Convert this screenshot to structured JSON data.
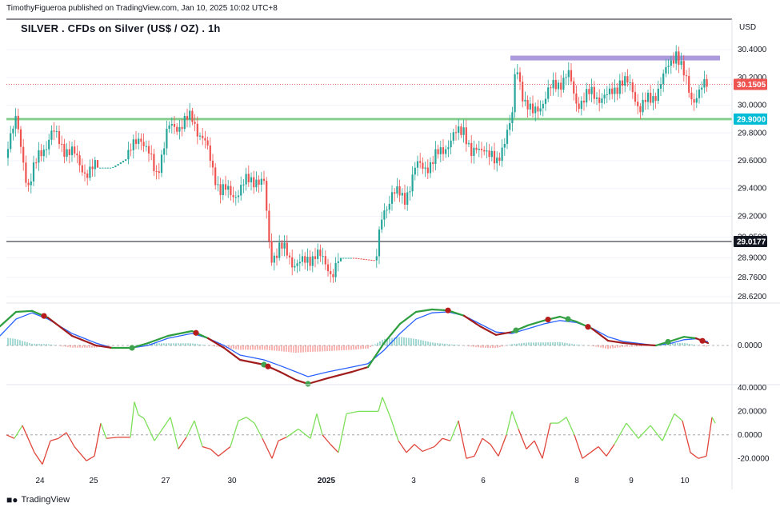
{
  "header": {
    "credit": "TimothyFigueroa published on TradingView.com, Jan 10, 2025 10:02 UTC+8",
    "title": "SILVER . CFDs on Silver (US$ / OZ) . 1h",
    "currency": "USD"
  },
  "footer": {
    "brand": "TradingView",
    "logo_icon": "tradingview-logo-icon"
  },
  "colors": {
    "up": "#26a69a",
    "down": "#ef5350",
    "grid": "#f0f3fa",
    "support_line": "#4caf50",
    "resistance_zone": "#9c88d6",
    "black_line": "#131722",
    "macd_fast": "#2e9e3f",
    "macd_slow": "#2962ff",
    "macd_down": "#a11d1d",
    "osc_up": "#7ee05a",
    "osc_down": "#e0463c"
  },
  "chart_data": [
    {
      "type": "candlestick",
      "title": "SILVER . CFDs on Silver (US$ / OZ) . 1h",
      "y_ticks": [
        28.62,
        28.76,
        28.9,
        29.05,
        29.2,
        29.4,
        29.6,
        29.8,
        30.0,
        30.2,
        30.4
      ],
      "y_tick_labels": [
        "28.6200",
        "28.7600",
        "28.9000",
        "29.0500",
        "29.2000",
        "29.4000",
        "29.6000",
        "29.8000",
        "30.0000",
        "30.2000",
        "30.4000"
      ],
      "ylim": [
        28.58,
        30.47
      ],
      "x_ticks": [
        "24",
        "25",
        "27",
        "30",
        "2025",
        "3",
        "6",
        "8",
        "9",
        "10"
      ],
      "price_markers": [
        {
          "label": "30.1505",
          "value": 30.1505,
          "style": "last-price"
        },
        {
          "label": "29.9000",
          "value": 29.9,
          "style": "support"
        },
        {
          "label": "29.0177",
          "value": 29.0177,
          "style": "level"
        }
      ],
      "horizontal_levels": [
        {
          "value": 29.9,
          "kind": "support"
        },
        {
          "value": 29.0177,
          "kind": "level"
        },
        {
          "value": 30.34,
          "kind": "resistance-zone"
        }
      ],
      "path_points": [
        [
          0,
          29.62
        ],
        [
          20,
          29.88
        ],
        [
          35,
          29.42
        ],
        [
          50,
          29.65
        ],
        [
          65,
          29.8
        ],
        [
          80,
          29.7
        ],
        [
          95,
          29.62
        ],
        [
          110,
          29.5
        ],
        [
          120,
          29.55
        ],
        [
          140,
          29.55
        ],
        [
          160,
          29.62
        ],
        [
          175,
          29.8
        ],
        [
          195,
          29.5
        ],
        [
          210,
          29.82
        ],
        [
          230,
          29.88
        ],
        [
          240,
          29.9
        ],
        [
          255,
          29.75
        ],
        [
          265,
          29.55
        ],
        [
          275,
          29.4
        ],
        [
          290,
          29.35
        ],
        [
          310,
          29.45
        ],
        [
          320,
          29.48
        ],
        [
          330,
          29.42
        ],
        [
          338,
          28.9
        ],
        [
          350,
          28.98
        ],
        [
          365,
          28.88
        ],
        [
          380,
          28.85
        ],
        [
          395,
          28.95
        ],
        [
          405,
          28.85
        ],
        [
          415,
          28.8
        ],
        [
          425,
          28.9
        ],
        [
          440,
          28.9
        ],
        [
          470,
          28.88
        ],
        [
          478,
          29.2
        ],
        [
          490,
          29.38
        ],
        [
          505,
          29.32
        ],
        [
          520,
          29.55
        ],
        [
          540,
          29.58
        ],
        [
          555,
          29.7
        ],
        [
          570,
          29.78
        ],
        [
          580,
          29.85
        ],
        [
          590,
          29.62
        ],
        [
          605,
          29.72
        ],
        [
          620,
          29.55
        ],
        [
          632,
          29.8
        ],
        [
          640,
          29.88
        ],
        [
          645,
          30.3
        ],
        [
          655,
          30.05
        ],
        [
          665,
          29.92
        ],
        [
          680,
          30.05
        ],
        [
          695,
          30.15
        ],
        [
          710,
          30.22
        ],
        [
          720,
          30.02
        ],
        [
          740,
          30.08
        ],
        [
          760,
          30.05
        ],
        [
          775,
          30.18
        ],
        [
          790,
          30.12
        ],
        [
          800,
          29.98
        ],
        [
          815,
          30.05
        ],
        [
          830,
          30.2
        ],
        [
          845,
          30.4
        ],
        [
          855,
          30.2
        ],
        [
          865,
          30.05
        ],
        [
          875,
          30.1
        ],
        [
          885,
          30.15
        ]
      ]
    },
    {
      "type": "line",
      "name": "MACD-style oscillator",
      "y_ticks": [
        0
      ],
      "y_tick_labels": [
        "0.0000"
      ],
      "fast": [
        [
          0,
          0.4
        ],
        [
          20,
          0.7
        ],
        [
          40,
          0.72
        ],
        [
          60,
          0.58
        ],
        [
          90,
          0.2
        ],
        [
          120,
          0.0
        ],
        [
          140,
          -0.05
        ],
        [
          165,
          -0.05
        ],
        [
          185,
          0.05
        ],
        [
          210,
          0.2
        ],
        [
          240,
          0.3
        ],
        [
          260,
          0.15
        ],
        [
          280,
          -0.05
        ],
        [
          300,
          -0.3
        ],
        [
          330,
          -0.4
        ],
        [
          350,
          -0.55
        ],
        [
          370,
          -0.72
        ],
        [
          385,
          -0.8
        ],
        [
          410,
          -0.68
        ],
        [
          440,
          -0.55
        ],
        [
          460,
          -0.45
        ],
        [
          480,
          0.05
        ],
        [
          500,
          0.45
        ],
        [
          520,
          0.7
        ],
        [
          540,
          0.75
        ],
        [
          560,
          0.73
        ],
        [
          580,
          0.62
        ],
        [
          600,
          0.4
        ],
        [
          620,
          0.22
        ],
        [
          640,
          0.28
        ],
        [
          660,
          0.42
        ],
        [
          680,
          0.52
        ],
        [
          700,
          0.6
        ],
        [
          720,
          0.5
        ],
        [
          740,
          0.35
        ],
        [
          760,
          0.1
        ],
        [
          780,
          0.05
        ],
        [
          800,
          0.02
        ],
        [
          820,
          0.0
        ],
        [
          840,
          0.1
        ],
        [
          855,
          0.18
        ],
        [
          870,
          0.15
        ],
        [
          885,
          0.05
        ]
      ],
      "slow": [
        [
          0,
          0.2
        ],
        [
          20,
          0.55
        ],
        [
          40,
          0.68
        ],
        [
          60,
          0.55
        ],
        [
          90,
          0.25
        ],
        [
          120,
          0.05
        ],
        [
          140,
          -0.05
        ],
        [
          165,
          -0.05
        ],
        [
          185,
          0.0
        ],
        [
          210,
          0.15
        ],
        [
          240,
          0.25
        ],
        [
          260,
          0.15
        ],
        [
          280,
          0.0
        ],
        [
          300,
          -0.2
        ],
        [
          330,
          -0.3
        ],
        [
          350,
          -0.42
        ],
        [
          370,
          -0.55
        ],
        [
          385,
          -0.65
        ],
        [
          410,
          -0.55
        ],
        [
          440,
          -0.45
        ],
        [
          460,
          -0.38
        ],
        [
          480,
          -0.1
        ],
        [
          500,
          0.25
        ],
        [
          520,
          0.55
        ],
        [
          540,
          0.68
        ],
        [
          560,
          0.7
        ],
        [
          580,
          0.62
        ],
        [
          600,
          0.45
        ],
        [
          620,
          0.28
        ],
        [
          640,
          0.25
        ],
        [
          660,
          0.35
        ],
        [
          680,
          0.45
        ],
        [
          700,
          0.52
        ],
        [
          720,
          0.48
        ],
        [
          740,
          0.36
        ],
        [
          760,
          0.18
        ],
        [
          780,
          0.08
        ],
        [
          800,
          0.04
        ],
        [
          820,
          0.0
        ],
        [
          840,
          0.05
        ],
        [
          855,
          0.12
        ],
        [
          870,
          0.14
        ],
        [
          885,
          0.08
        ]
      ],
      "cross_up": [
        165,
        330,
        385,
        645,
        710,
        835
      ],
      "cross_down": [
        55,
        245,
        335,
        560,
        685,
        735,
        878
      ]
    },
    {
      "type": "line",
      "name": "Oscillator",
      "y_ticks": [
        40,
        20,
        0,
        -20
      ],
      "y_tick_labels": [
        "40.0000",
        "20.0000",
        "0.0000",
        "-20.0000"
      ],
      "ylim": [
        -30,
        42
      ],
      "values": [
        [
          0,
          0
        ],
        [
          10,
          -3
        ],
        [
          20,
          8
        ],
        [
          35,
          -15
        ],
        [
          45,
          -25
        ],
        [
          55,
          -5
        ],
        [
          65,
          -3
        ],
        [
          75,
          2
        ],
        [
          85,
          -10
        ],
        [
          100,
          -22
        ],
        [
          110,
          -18
        ],
        [
          118,
          10
        ],
        [
          125,
          -3
        ],
        [
          140,
          -2
        ],
        [
          155,
          -2
        ],
        [
          160,
          28
        ],
        [
          165,
          17
        ],
        [
          172,
          14
        ],
        [
          185,
          -5
        ],
        [
          195,
          5
        ],
        [
          205,
          15
        ],
        [
          215,
          -12
        ],
        [
          225,
          -2
        ],
        [
          235,
          12
        ],
        [
          245,
          -10
        ],
        [
          255,
          -12
        ],
        [
          265,
          -18
        ],
        [
          280,
          -10
        ],
        [
          290,
          12
        ],
        [
          300,
          15
        ],
        [
          310,
          10
        ],
        [
          320,
          -3
        ],
        [
          332,
          -20
        ],
        [
          340,
          -5
        ],
        [
          350,
          -2
        ],
        [
          365,
          5
        ],
        [
          380,
          -3
        ],
        [
          388,
          18
        ],
        [
          395,
          0
        ],
        [
          405,
          -8
        ],
        [
          415,
          -15
        ],
        [
          425,
          18
        ],
        [
          440,
          20
        ],
        [
          465,
          20
        ],
        [
          470,
          32
        ],
        [
          480,
          15
        ],
        [
          490,
          -5
        ],
        [
          500,
          -15
        ],
        [
          510,
          -8
        ],
        [
          520,
          -14
        ],
        [
          535,
          -10
        ],
        [
          545,
          -3
        ],
        [
          555,
          -5
        ],
        [
          565,
          12
        ],
        [
          575,
          -20
        ],
        [
          585,
          -18
        ],
        [
          595,
          -3
        ],
        [
          605,
          -8
        ],
        [
          615,
          -18
        ],
        [
          625,
          0
        ],
        [
          632,
          20
        ],
        [
          640,
          5
        ],
        [
          650,
          -12
        ],
        [
          660,
          -5
        ],
        [
          670,
          -20
        ],
        [
          680,
          10
        ],
        [
          690,
          10
        ],
        [
          700,
          15
        ],
        [
          710,
          0
        ],
        [
          720,
          -20
        ],
        [
          730,
          -15
        ],
        [
          740,
          -10
        ],
        [
          750,
          -18
        ],
        [
          760,
          -8
        ],
        [
          775,
          10
        ],
        [
          790,
          -3
        ],
        [
          805,
          8
        ],
        [
          820,
          -5
        ],
        [
          835,
          18
        ],
        [
          845,
          12
        ],
        [
          855,
          -15
        ],
        [
          865,
          -20
        ],
        [
          875,
          -18
        ],
        [
          882,
          15
        ],
        [
          886,
          10
        ]
      ]
    }
  ]
}
